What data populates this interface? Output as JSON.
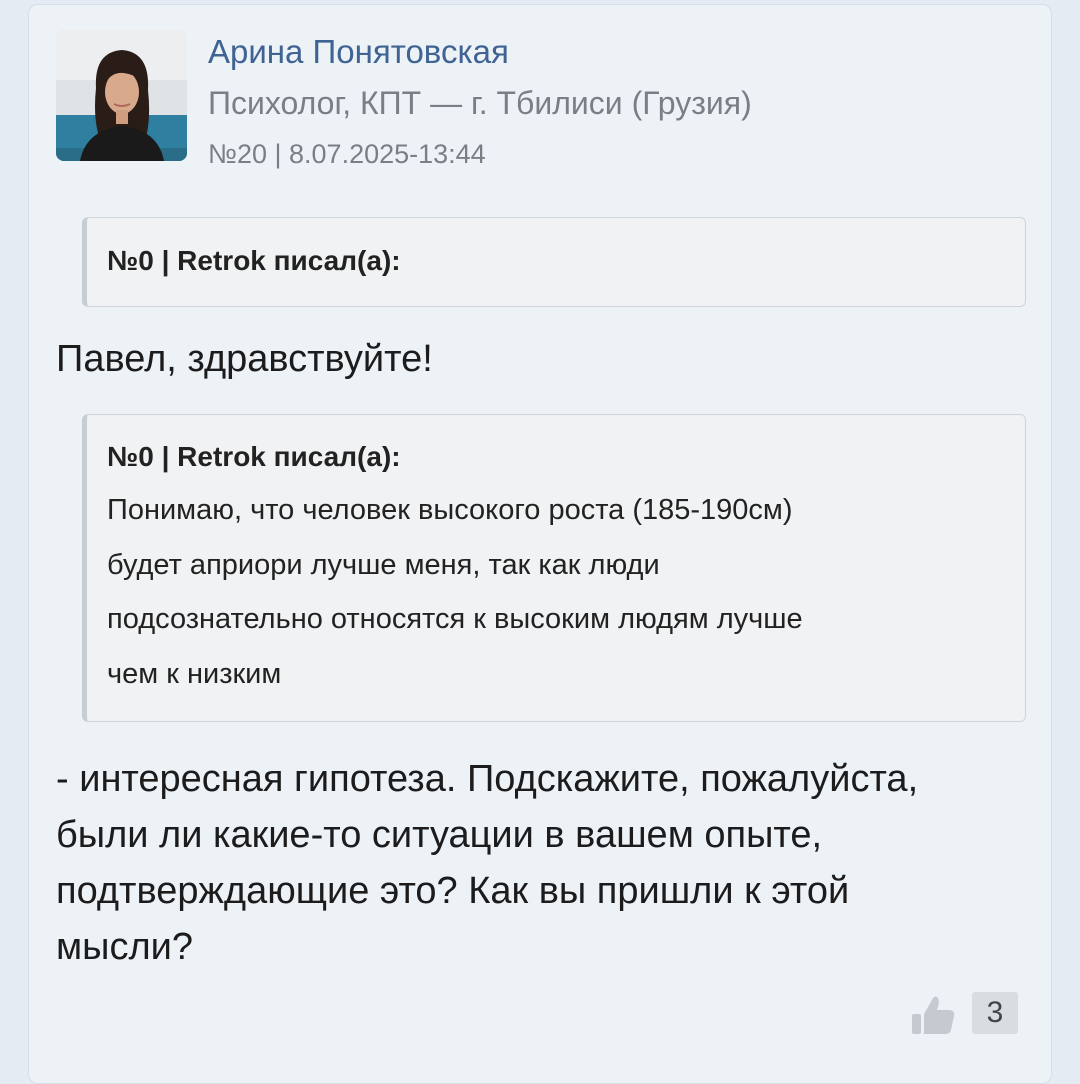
{
  "post": {
    "author_name": "Арина Понятовская",
    "author_role": "Психолог, КПТ — г. Тбилиси (Грузия)",
    "meta": "№20 | 8.07.2025-13:44",
    "quote_1": {
      "header": "№0 | Retrok писал(а):"
    },
    "greeting": "Павел, здравствуйте!",
    "quote_2": {
      "header": "№0 | Retrok писал(а):",
      "lines": [
        "Понимаю, что человек высокого роста (185-190см)",
        "будет априори лучше меня, так как люди",
        "подсознательно относятся к высоким людям лучше",
        "чем к низким"
      ]
    },
    "answer_lines": [
      "- интересная гипотеза. Подскажите, пожалуйста,",
      "были ли какие-то ситуации в вашем опыте,",
      "подтверждающие это? Как вы пришли к этой",
      "мысли?"
    ],
    "likes": {
      "icon": "thumbs-up-icon",
      "count": "3"
    }
  },
  "colors": {
    "author_link": "#3f6393",
    "secondary_text": "#7a7f86",
    "card_bg": "#edf2f7",
    "quote_bg": "#f1f2f3"
  }
}
